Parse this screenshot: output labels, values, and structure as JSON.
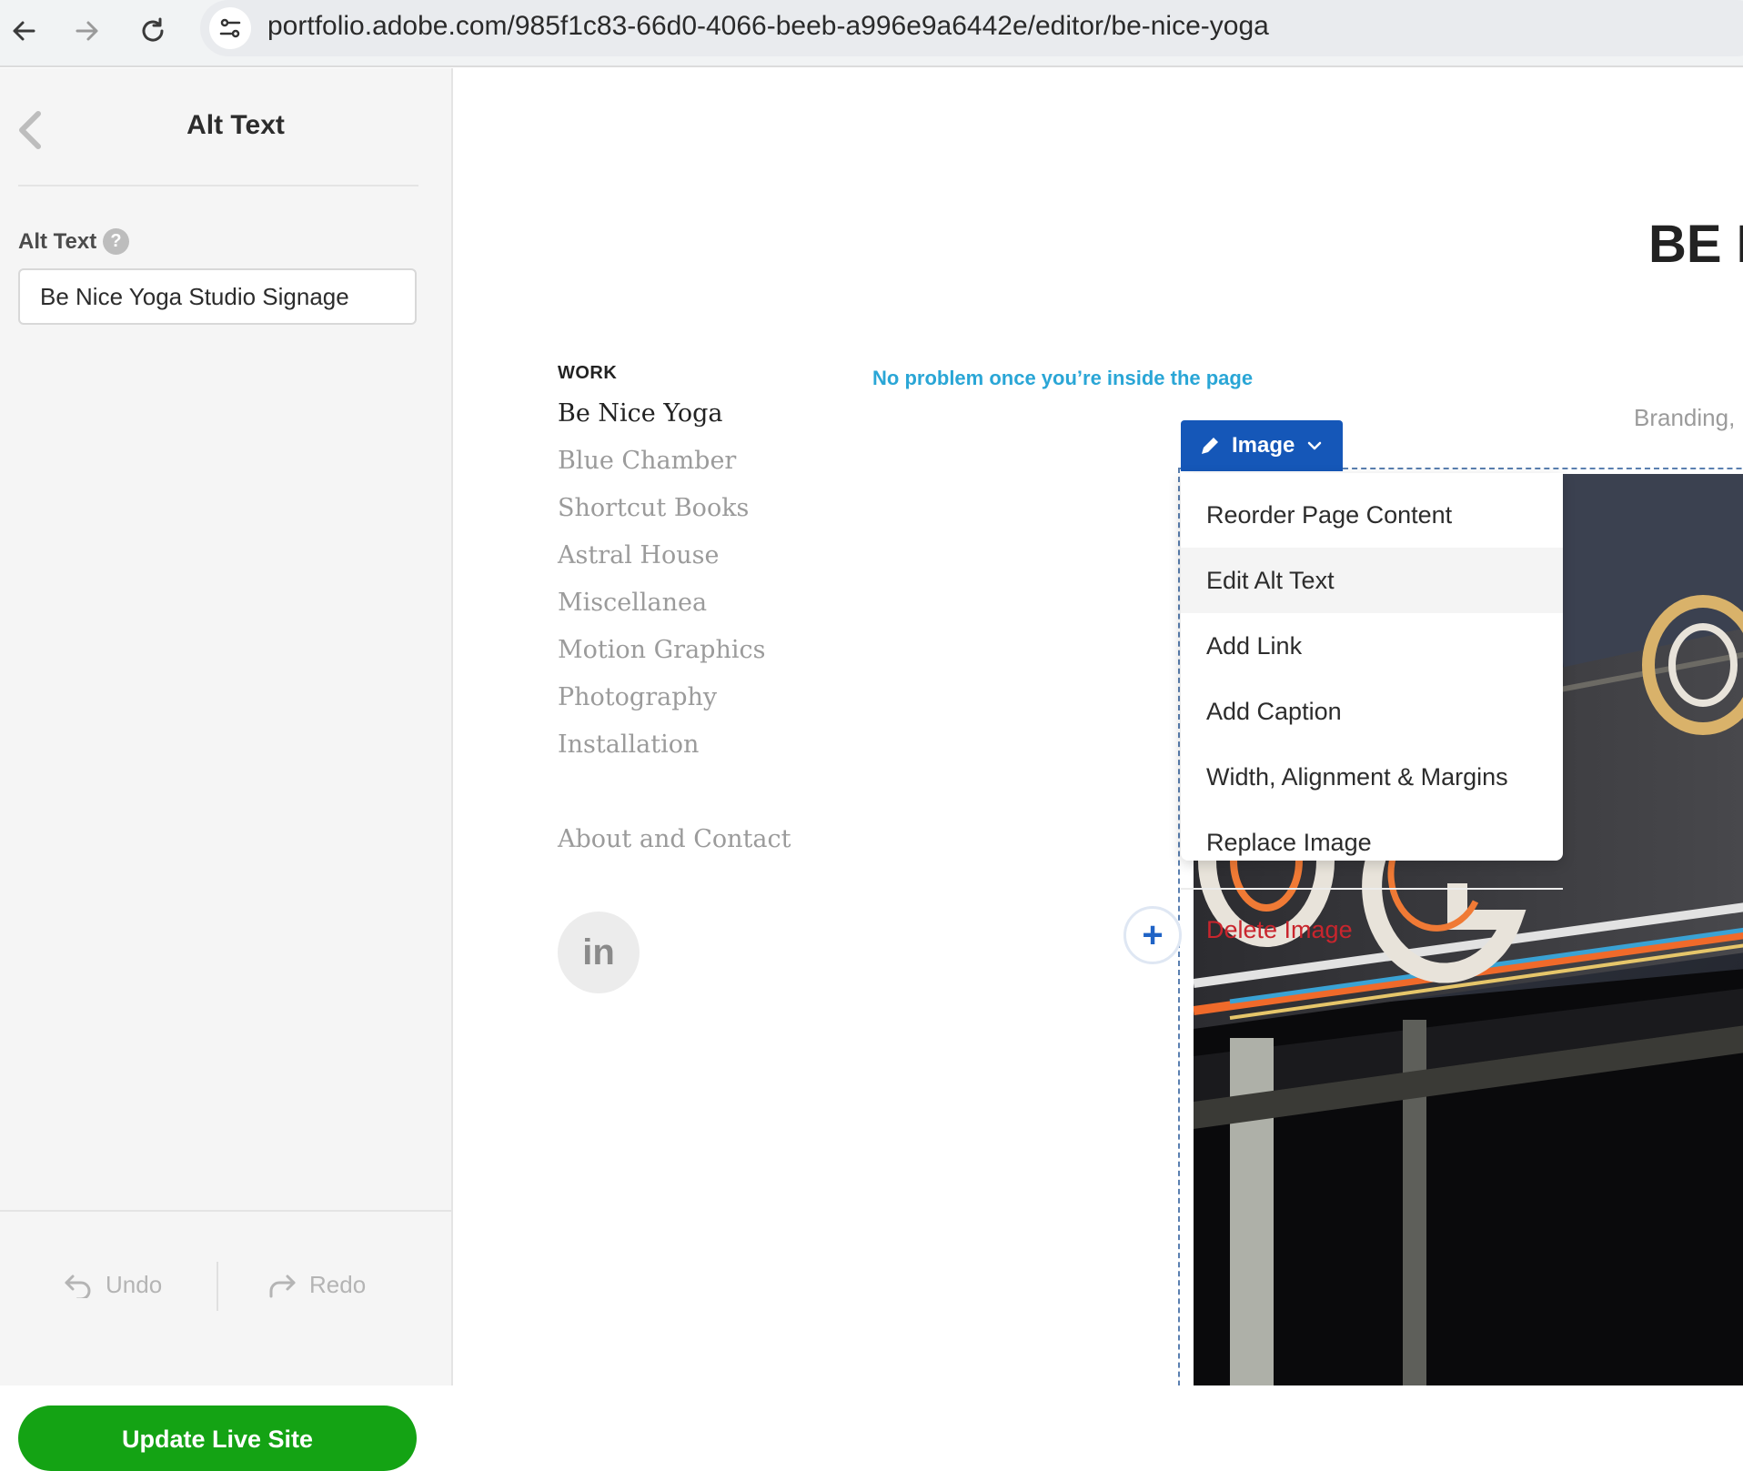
{
  "browser": {
    "url": "portfolio.adobe.com/985f1c83-66d0-4066-beeb-a996e9a6442e/editor/be-nice-yoga"
  },
  "panel": {
    "title": "Alt Text",
    "field_label": "Alt Text",
    "help": "?",
    "alt_value": "Be Nice Yoga Studio Signage",
    "undo_label": "Undo",
    "redo_label": "Redo",
    "update_label": "Update Live Site",
    "update_color": "#14a314"
  },
  "site": {
    "title": "BE N",
    "work_heading": "WORK",
    "work_items": [
      "Be Nice Yoga",
      "Blue Chamber",
      "Shortcut Books",
      "Astral House",
      "Miscellanea",
      "Motion Graphics",
      "Photography",
      "Installation"
    ],
    "about_label": "About and Contact",
    "linkedin_label": "in",
    "annotation": "No problem once you’re inside the page",
    "branding": "Branding,"
  },
  "image_toolbar": {
    "label": "Image",
    "accent": "#1557b8"
  },
  "image_menu": {
    "items": [
      "Reorder Page Content",
      "Edit Alt Text",
      "Add Link",
      "Add Caption",
      "Width, Alignment & Margins",
      "Replace Image"
    ],
    "delete_label": "Delete Image",
    "delete_color": "#c9252d"
  },
  "add_block": "+"
}
